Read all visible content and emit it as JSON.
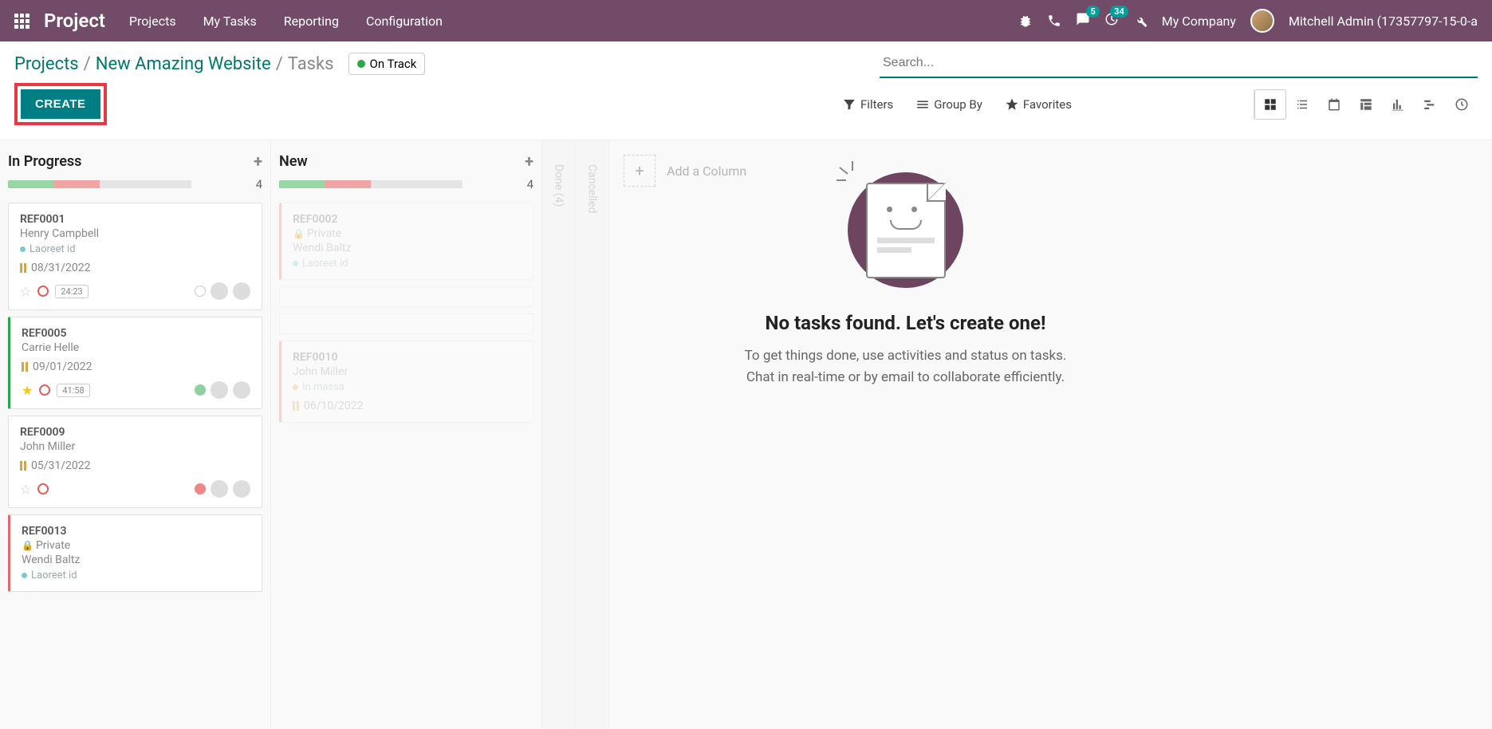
{
  "nav": {
    "brand": "Project",
    "menu": [
      "Projects",
      "My Tasks",
      "Reporting",
      "Configuration"
    ],
    "msg_badge": "5",
    "act_badge": "34",
    "company": "My Company",
    "user": "Mitchell Admin (17357797-15-0-a"
  },
  "breadcrumb": {
    "root": "Projects",
    "project": "New Amazing Website",
    "leaf": "Tasks",
    "status": "On Track"
  },
  "search": {
    "placeholder": "Search..."
  },
  "buttons": {
    "create": "CREATE"
  },
  "search_opts": {
    "filters": "Filters",
    "groupby": "Group By",
    "favorites": "Favorites"
  },
  "columns": {
    "in_progress": {
      "title": "In Progress",
      "count": "4",
      "segs": [
        {
          "w": "25%",
          "c": "#96d7a3"
        },
        {
          "w": "25%",
          "c": "#f2a3a3"
        }
      ],
      "cards": [
        {
          "accent": "",
          "ref": "REF0001",
          "private": false,
          "person": "Henry Campbell",
          "tag": "Laoreet id",
          "tagcolor": "teal",
          "date": "08/31/2022",
          "star": false,
          "time": "24:23",
          "status": "",
          "showtime": true,
          "showfoot": true
        },
        {
          "accent": "green",
          "ref": "REF0005",
          "private": false,
          "person": "Carrie Helle",
          "tag": "",
          "tagcolor": "",
          "date": "09/01/2022",
          "star": true,
          "time": "41:58",
          "status": "green",
          "showtime": true,
          "showfoot": true
        },
        {
          "accent": "",
          "ref": "REF0009",
          "private": false,
          "person": "John Miller",
          "tag": "",
          "tagcolor": "",
          "date": "05/31/2022",
          "star": false,
          "time": "",
          "status": "red",
          "showtime": false,
          "showfoot": true
        },
        {
          "accent": "red",
          "ref": "REF0013",
          "private": true,
          "person": "Wendi Baltz",
          "tag": "Laoreet id",
          "tagcolor": "teal",
          "date": "",
          "star": false,
          "time": "",
          "status": "",
          "showtime": false,
          "showfoot": false
        }
      ]
    },
    "new": {
      "title": "New",
      "count": "4",
      "segs": [
        {
          "w": "25%",
          "c": "#96d7a3"
        },
        {
          "w": "25%",
          "c": "#f2a3a3"
        }
      ],
      "cards": [
        {
          "accent": "red",
          "ref": "REF0002",
          "private": true,
          "person": "Wendi Baltz",
          "tag": "Laoreet id",
          "tagcolor": "teal",
          "date": "",
          "star": false,
          "time": "",
          "status": "",
          "showtime": false,
          "showfoot": false
        },
        {
          "accent": "",
          "ref": "",
          "private": false,
          "person": "",
          "tag": "",
          "tagcolor": "",
          "date": "",
          "star": false,
          "time": "",
          "status": "",
          "showtime": false,
          "showfoot": false
        },
        {
          "accent": "",
          "ref": "",
          "private": false,
          "person": "",
          "tag": "",
          "tagcolor": "",
          "date": "",
          "star": false,
          "time": "",
          "status": "",
          "showtime": false,
          "showfoot": false
        },
        {
          "accent": "red",
          "ref": "REF0010",
          "private": false,
          "person": "John Miller",
          "tag": "In massa",
          "tagcolor": "orange",
          "date": "06/10/2022",
          "star": false,
          "time": "",
          "status": "",
          "showtime": false,
          "showfoot": false
        }
      ]
    },
    "folded": [
      "Done (4)",
      "Cancelled"
    ],
    "addcol": "Add a Column"
  },
  "empty": {
    "title": "No tasks found. Let's create one!",
    "line1": "To get things done, use activities and status on tasks.",
    "line2": "Chat in real-time or by email to collaborate efficiently."
  }
}
